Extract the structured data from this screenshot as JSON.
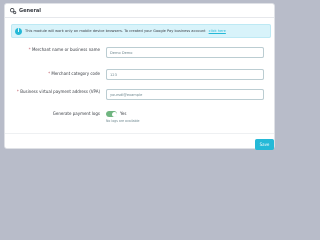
{
  "panel": {
    "title": "General",
    "icon": "gears-icon"
  },
  "alert": {
    "text": "This module will work only on mobile device browsers. To created your Google Pay business account",
    "link": "click here"
  },
  "form": {
    "merchant_name": {
      "label": "Merchant name or business name",
      "required": "*",
      "value": "Demo Demo"
    },
    "merchant_category": {
      "label": "Merchant category code",
      "required": "*",
      "value": "123"
    },
    "vpa": {
      "label": "Business virtual payment address (VPA)",
      "required": "*",
      "value": "yoursdl@example"
    },
    "payment_logs": {
      "label": "Generate payment logs",
      "toggle_label": "Yes",
      "help": "No logs are available",
      "enabled": true
    }
  },
  "actions": {
    "save_label": "Save"
  },
  "colors": {
    "accent": "#25b9d7",
    "toggle_on": "#70b580",
    "required": "#c05c67"
  }
}
